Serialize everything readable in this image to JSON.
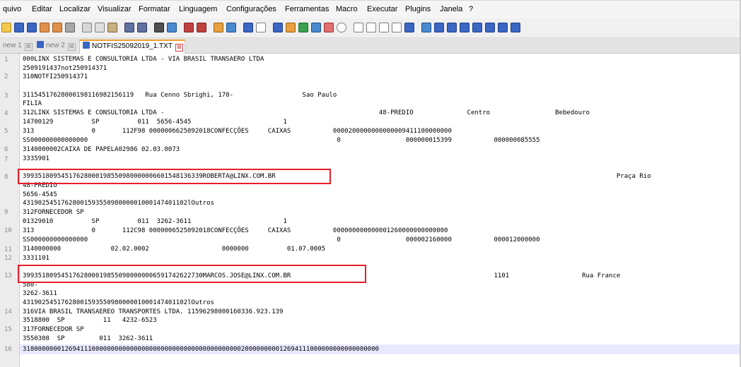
{
  "menu": [
    "quivo",
    "Editar",
    "Localizar",
    "Visualizar",
    "Formatar",
    "Linguagem",
    "Configurações",
    "Ferramentas",
    "Macro",
    "Executar",
    "Plugins",
    "Janela",
    "?"
  ],
  "tabs": [
    {
      "label": "new 1",
      "close": "⊠"
    },
    {
      "label": "new 2",
      "close": "⊠"
    },
    {
      "label": "NOTFIS25092019_1.TXT",
      "close": "⊠"
    }
  ],
  "toolbar_icons": [
    "open-icon",
    "save-icon",
    "save-all-icon",
    "close-icon",
    "close-all-icon",
    "print-icon",
    "cut-icon",
    "copy-icon",
    "paste-icon",
    "undo-icon",
    "redo-icon",
    "find-icon",
    "replace-icon",
    "zoom-in-icon",
    "zoom-out-icon",
    "sync-v-icon",
    "sync-h-icon",
    "wrap-icon",
    "all-chars-icon",
    "indent-guide-icon",
    "udl-icon",
    "doc-map-icon",
    "function-list-icon",
    "folder-workspace-icon",
    "monitor-icon",
    "record-icon",
    "stop-icon",
    "play-icon",
    "play-multi-icon",
    "save-macro-icon",
    "spell-icon",
    "compare-icon",
    "compare-icon-2",
    "nav-first-icon",
    "nav-up-icon",
    "nav-down-icon",
    "nav-last-icon",
    "table-icon"
  ],
  "gutter": [
    "1",
    "2",
    "3",
    "4",
    "5",
    "6",
    "7",
    "8",
    "9",
    "10",
    "11",
    "12",
    "13",
    "14",
    "15",
    "16"
  ],
  "lines": [
    "000LINX SISTEMAS E CONSULTORIA LTDA - VIA BRASIL TRANSAERO LTDA",
    "2509191437not250914371",
    "310NOTFI250914371",
    "31154517628000198116982156119   Rua Cenno Sbrighi, 170-                  Sao Paulo",
    "FILIA",
    "312LINX SISTEMAS E CONSULTORIA LTDA -                                                        48-PREDIO              Centro                 Bebedouro",
    "14700129          SP          011  5656-4545                        1",
    "313               0       112F98 000000б625092018CONFECÇÕES     CAIXAS           0000200000000000009411100000000",
    "SS000000000000000                                                                 0                 000000015399           000000085555",
    "3140000002CAIXA DE PAPELA02986 02.03.0073",
    "3335901",
    "39935180954517628000198550980000006601548136339ROBERTA@LINX.COM.BR                                                                                         Praça Rio",
    "48-PREDIO",
    "5656-4545",
    "4319025451762800159355098000001000147401102lOutros",
    "312FORNECEDOR SP",
    "01329010          SP          011  3262-3611                        1",
    "313               0       112C98 0000006525092018CONFECÇÕES     CAIXAS           000000000000001260000000000000",
    "SS000000000000000                                                                 0                 000002160000           000012000000",
    "3140000000             02.02.0002                   0000000          01.07.0005",
    "3331101",
    "39935180954517628000198550980000006591742622730MARCOS.JOSE@LINX.COM.BR                                                     1101                   Rua France",
    "580-",
    "3262-3611",
    "4319025451762800159355098000001000147401102lOutros",
    "316VIA BRASIL TRANSAEREO TRANSPORTES LTDA. 11596298000160336.923.139",
    "3518800  SP          11   4232-6523",
    "317FORNECEDOR SP",
    "3550308  SP         011  3262-3611",
    "318000000012694111000000000000000000000000000000000000000200000000012694111000000000000000000"
  ]
}
